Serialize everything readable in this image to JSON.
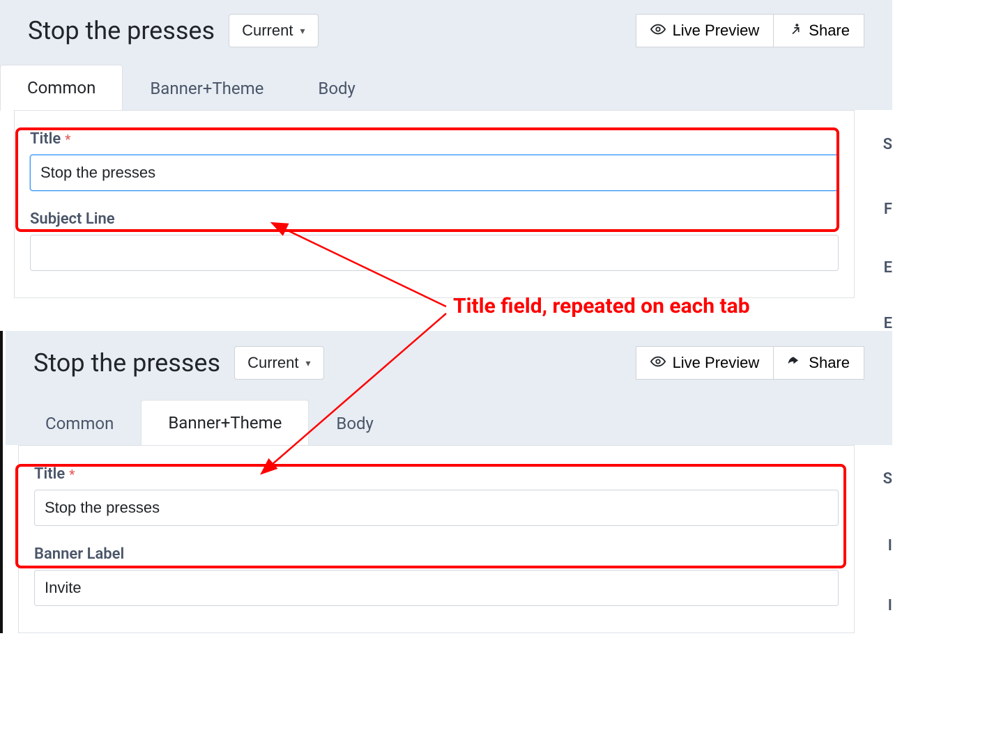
{
  "panel1": {
    "header": {
      "title": "Stop the presses",
      "dropdown_label": "Current",
      "live_preview_label": "Live Preview",
      "share_label": "Share"
    },
    "tabs": [
      {
        "label": "Common",
        "active": true
      },
      {
        "label": "Banner+Theme",
        "active": false
      },
      {
        "label": "Body",
        "active": false
      }
    ],
    "fields": {
      "title_label": "Title",
      "title_value": "Stop the presses",
      "subject_label": "Subject Line",
      "subject_value": ""
    },
    "side_hints": [
      "S",
      "F",
      "E",
      "E"
    ]
  },
  "panel2": {
    "header": {
      "title": "Stop the presses",
      "dropdown_label": "Current",
      "live_preview_label": "Live Preview",
      "share_label": "Share"
    },
    "tabs": [
      {
        "label": "Common",
        "active": false
      },
      {
        "label": "Banner+Theme",
        "active": true
      },
      {
        "label": "Body",
        "active": false
      }
    ],
    "fields": {
      "title_label": "Title",
      "title_value": "Stop the presses",
      "banner_label_label": "Banner Label",
      "banner_label_value": "Invite"
    },
    "side_hints": [
      "S",
      "I",
      "I"
    ]
  },
  "annotation": "Title field, repeated on each tab"
}
